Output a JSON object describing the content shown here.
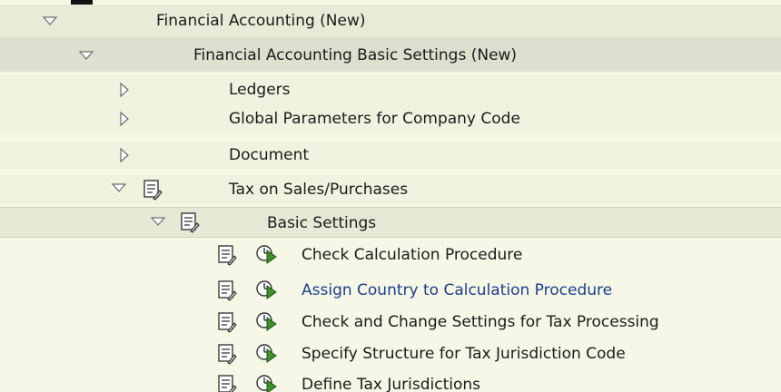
{
  "tree": {
    "nodes": [
      {
        "label": "Financial Accounting (New)",
        "state": "expanded"
      },
      {
        "label": "Financial Accounting Basic Settings (New)",
        "state": "expanded"
      },
      {
        "label": "Ledgers",
        "state": "collapsed"
      },
      {
        "label": "Global Parameters for Company Code",
        "state": "collapsed"
      },
      {
        "label": "Document",
        "state": "collapsed"
      },
      {
        "label": "Tax on Sales/Purchases",
        "state": "expanded",
        "icon": "documentation-icon"
      },
      {
        "label": "Basic Settings",
        "state": "expanded",
        "icon": "documentation-icon"
      },
      {
        "label": "Check Calculation Procedure",
        "icons": [
          "documentation-icon",
          "execute-clock-icon"
        ]
      },
      {
        "label": "Assign Country to Calculation Procedure",
        "icons": [
          "documentation-icon",
          "execute-clock-icon"
        ],
        "highlighted": true
      },
      {
        "label": "Check and Change Settings for Tax Processing",
        "icons": [
          "documentation-icon",
          "execute-clock-icon"
        ]
      },
      {
        "label": "Specify Structure for Tax Jurisdiction Code",
        "icons": [
          "documentation-icon",
          "execute-clock-icon"
        ]
      },
      {
        "label": "Define Tax Jurisdictions",
        "icons": [
          "documentation-icon",
          "execute-clock-icon"
        ]
      }
    ]
  },
  "colors": {
    "background": "#f6f7e6",
    "level1_row": "#e9ebd8",
    "level2_row": "#dedfce",
    "link_text": "#1c3f8c",
    "clock_green": "#3f8f2a"
  }
}
